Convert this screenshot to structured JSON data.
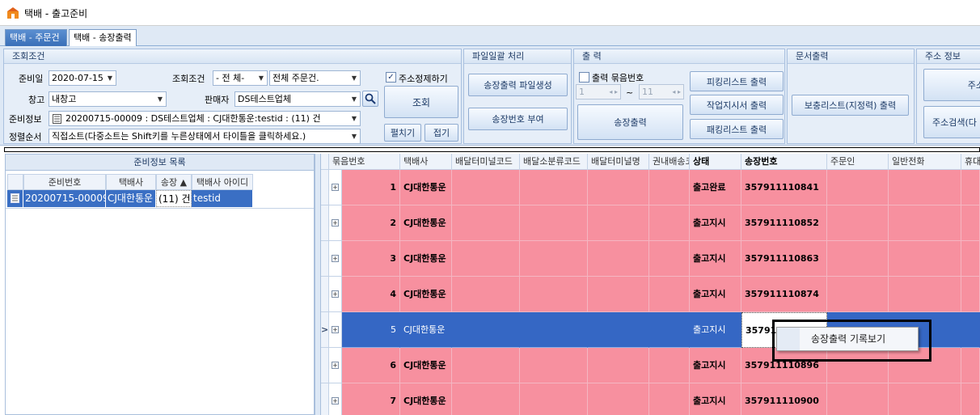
{
  "window": {
    "title": "택배 - 출고준비"
  },
  "tabs": [
    {
      "label": "택배 - 주문건"
    },
    {
      "label": "택배 - 송장출력"
    }
  ],
  "search": {
    "group_title": "조회조건",
    "date_label": "준비일",
    "date_value": "2020-07-15",
    "condition_label": "조회조건",
    "condition_value": "- 전  체-",
    "condition2_value": "전체 주문건.",
    "warehouse_label": "창고",
    "warehouse_value": "내창고",
    "seller_label": "판매자",
    "seller_value": "DS테스트업체",
    "info_label": "준비정보",
    "info_value": "20200715-00009 : DS테스트업체 : CJ대한통운:testid : (11) 건",
    "sort_label": "정렬순서",
    "sort_value": "직접소트(다중소트는 Shift키를 누른상태에서 타이틀을 클릭하세요.)",
    "address_clean_label": "주소정제하기",
    "search_button": "조회",
    "expand_button": "펼치기",
    "collapse_button": "접기"
  },
  "file_group": {
    "title": "파일일괄 처리",
    "generate_button": "송장출력 파일생성",
    "assign_button": "송장번호 부여"
  },
  "print_group": {
    "title": "출  력",
    "bundle_label": "출력 묶음번호",
    "range_from": "1",
    "range_sep": "~",
    "range_to": "11",
    "print_invoice_button": "송장출력",
    "picking_button": "피킹리스트 출력",
    "work_order_button": "작업지시서 출력",
    "packing_button": "패킹리스트 출력"
  },
  "doc_group": {
    "title": "문서출력",
    "supplement_button": "보충리스트(지정력) 출력"
  },
  "address_group": {
    "title": "주소 정보",
    "btn1": "주소",
    "btn2": "주소검색(다"
  },
  "left_grid": {
    "title": "준비정보 목록",
    "columns": [
      "준비번호",
      "택배사",
      "송장 ▲",
      "택배사 아이디"
    ],
    "row": {
      "prep_no": "20200715-00009",
      "courier": "CJ대한통운",
      "count": "(11) 건",
      "courier_id": "testid"
    }
  },
  "main_grid": {
    "columns": [
      "묶음번호",
      "택배사",
      "배달터미널코드",
      "배달소분류코드",
      "배달터미널명",
      "권내배송코드",
      "상태",
      "송장번호",
      "주문인",
      "일반전화",
      "휴대"
    ],
    "rows": [
      {
        "bundle": "1",
        "courier": "CJ대한통운",
        "status": "출고완료",
        "invoice": "357911110841"
      },
      {
        "bundle": "2",
        "courier": "CJ대한통운",
        "status": "출고지시",
        "invoice": "357911110852"
      },
      {
        "bundle": "3",
        "courier": "CJ대한통운",
        "status": "출고지시",
        "invoice": "357911110863"
      },
      {
        "bundle": "4",
        "courier": "CJ대한통운",
        "status": "출고지시",
        "invoice": "357911110874"
      },
      {
        "bundle": "5",
        "courier": "CJ대한통운",
        "status": "출고지시",
        "invoice": "35791"
      },
      {
        "bundle": "6",
        "courier": "CJ대한통운",
        "status": "출고지시",
        "invoice": "357911110896"
      },
      {
        "bundle": "7",
        "courier": "CJ대한통운",
        "status": "출고지시",
        "invoice": "357911110900"
      }
    ],
    "current_row_marker": ">"
  },
  "context_menu": {
    "item": "송장출력 기록보기"
  },
  "colors": {
    "row_pink": "#f7909f",
    "row_selected": "#3567c4",
    "ribbon_bg": "#dde8f5"
  }
}
